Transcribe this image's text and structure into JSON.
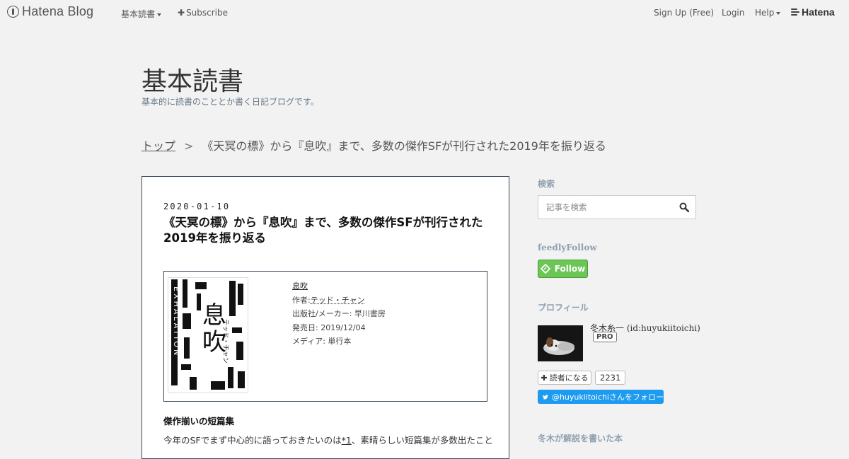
{
  "global_header": {
    "brand": "Hatena Blog",
    "blog_menu_label": "基本読書",
    "subscribe_label": "Subscribe",
    "signup_label": "Sign Up (Free)",
    "login_label": "Login",
    "help_label": "Help",
    "hatena_label": "Hatena"
  },
  "blog": {
    "title": "基本読書",
    "description": "基本的に読書のこととか書く日記ブログです。"
  },
  "breadcrumb": {
    "top_label": "トップ",
    "separator": ">",
    "current": "《天冥の標》から『息吹』まで、多数の傑作SFが刊行された2019年を振り返る"
  },
  "article": {
    "date": "2020-01-10",
    "title": "《天冥の標》から『息吹』まで、多数の傑作SFが刊行された2019年を振り返る",
    "book": {
      "title": "息吹",
      "author_prefix": "作者:",
      "author": "テッド・チャン",
      "publisher": "出版社/メーカー: 早川書房",
      "release": "発売日: 2019/12/04",
      "media": "メディア: 単行本",
      "cover_text_main": "息吹",
      "cover_text_latin": "EXHALATION",
      "cover_author": "テッド・チャン"
    },
    "section_heading": "傑作揃いの短篇集",
    "para_start": "今年のSFでまず中心的に語っておきたいのは",
    "footnote_ref": "*1",
    "para_end": "、素晴らしい短篇集が多数出たこと"
  },
  "sidebar": {
    "search_heading": "検索",
    "search_placeholder": "記事を検索",
    "feedly_heading": "feedlyFollow",
    "feedly_button": "Follow",
    "profile_heading": "プロフィール",
    "profile_name": "冬木糸一 (id:huyukiitoichi)",
    "pro_badge": "PRO",
    "reader_button": "読者になる",
    "reader_count": "2231",
    "twitter_button": "@huyukiitoichiさんをフォロー",
    "books_heading": "冬木が解説を書いた本"
  },
  "colors": {
    "background": "#f2f2f2",
    "feedly_green": "#6cc655",
    "twitter_blue": "#1d9bf0",
    "sidebar_heading": "#8fa0b0"
  }
}
